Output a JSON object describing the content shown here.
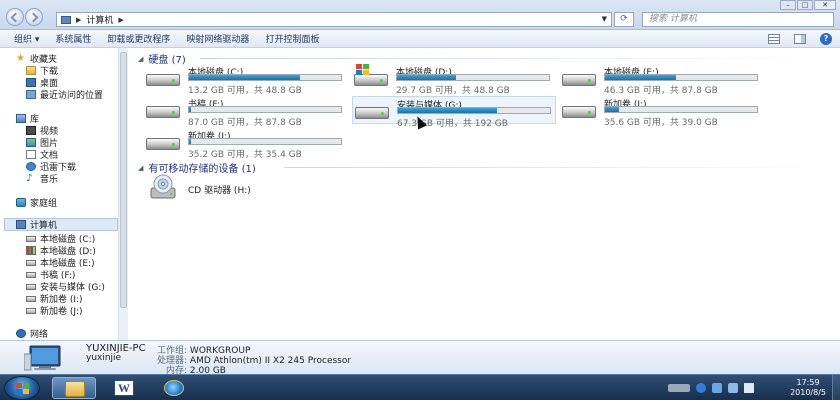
{
  "addressbar": {
    "path_root": "计算机",
    "search_placeholder": "搜索 计算机"
  },
  "toolbar": {
    "items": [
      "组织 ▾",
      "系统属性",
      "卸载或更改程序",
      "映射网络驱动器",
      "打开控制面板"
    ]
  },
  "nav": {
    "favorites": "收藏夹",
    "downloads": "下载",
    "desktop": "桌面",
    "recent": "最近访问的位置",
    "libraries": "库",
    "videos": "视频",
    "pictures": "图片",
    "documents": "文档",
    "thunder": "迅雷下载",
    "music": "音乐",
    "homegroup": "家庭组",
    "computer": "计算机",
    "drives": [
      "本地磁盘 (C:)",
      "本地磁盘 (D:)",
      "本地磁盘 (E:)",
      "书稿 (F:)",
      "安装与媒体 (G:)",
      "新加卷 (I:)",
      "新加卷 (J:)"
    ],
    "network": "网络"
  },
  "content": {
    "hdd_group": "硬盘 (7)",
    "removable_group": "有可移动存储的设备 (1)",
    "drives": [
      {
        "name": "本地磁盘 (C:)",
        "info": "13.2 GB 可用，共 48.8 GB",
        "used": 0.73
      },
      {
        "name": "本地磁盘 (D:)",
        "info": "29.7 GB 可用，共 48.8 GB",
        "used": 0.39
      },
      {
        "name": "本地磁盘 (E:)",
        "info": "46.3 GB 可用，共 87.8 GB",
        "used": 0.47
      },
      {
        "name": "书稿 (F:)",
        "info": "87.0 GB 可用，共 87.8 GB",
        "used": 0.01
      },
      {
        "name": "安装与媒体 (G:)",
        "info": "67.3 GB 可用，共 192 GB",
        "used": 0.65
      },
      {
        "name": "新加卷 (I:)",
        "info": "35.6 GB 可用，共 39.0 GB",
        "used": 0.09
      },
      {
        "name": "新加卷 (J:)",
        "info": "35.2 GB 可用，共 35.4 GB",
        "used": 0.01
      }
    ],
    "cd_drive": "CD 驱动器 (H:)"
  },
  "details": {
    "computer_name": "YUXINJIE-PC",
    "user": "yuxinjie",
    "workgroup_label": "工作组:",
    "workgroup": "WORKGROUP",
    "processor_label": "处理器:",
    "processor": "AMD Athlon(tm) II X2 245 Processor",
    "memory_label": "内存:",
    "memory": "2.00 GB"
  },
  "taskbar": {
    "time": "17:59",
    "date": "2010/8/5"
  },
  "colors": {
    "bar_fill": "#1a6fae",
    "group_header": "#1e3287"
  }
}
